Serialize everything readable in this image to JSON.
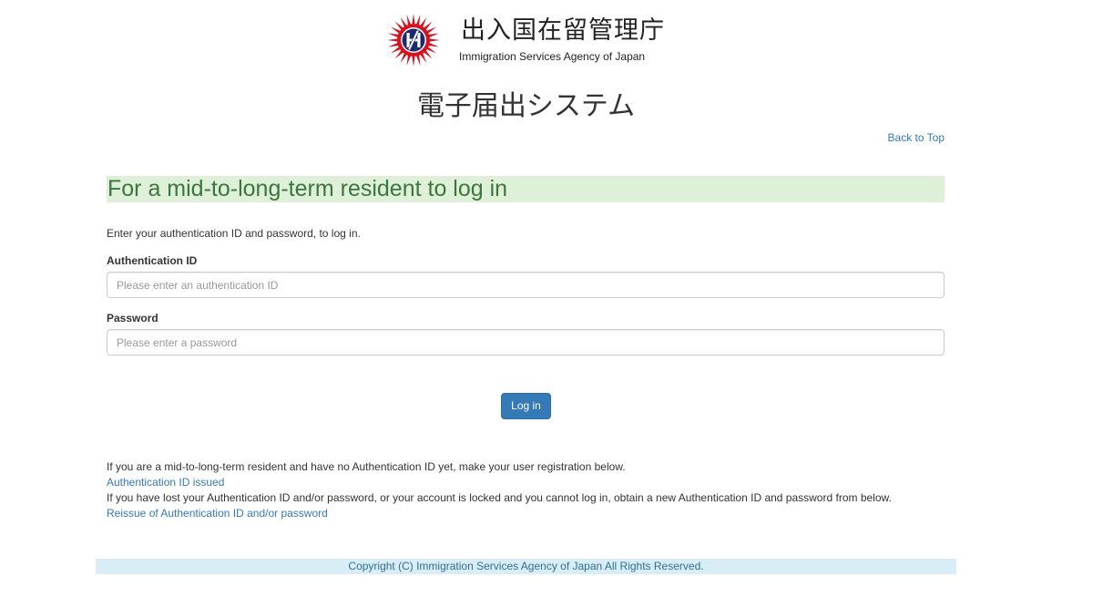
{
  "header": {
    "agency_name_jp": "出入国在留管理庁",
    "agency_name_en": "Immigration Services Agency of Japan",
    "system_title": "電子届出システム",
    "back_to_top": "Back to Top",
    "emblem_icon": "agency-emblem-icon"
  },
  "login": {
    "heading": "For a mid-to-long-term resident to log in",
    "intro": "Enter your authentication ID and password, to log in.",
    "auth_id_label": "Authentication ID",
    "auth_id_placeholder": "Please enter an authentication ID",
    "auth_id_value": "",
    "password_label": "Password",
    "password_placeholder": "Please enter a password",
    "password_value": "",
    "submit_label": "Log in"
  },
  "help": {
    "registration_text": "If you are a mid-to-long-term resident and have no Authentication ID yet, make your user registration below.",
    "registration_link": "Authentication ID issued",
    "reissue_text": "If you have lost your Authentication ID and/or password, or your account is locked and you cannot log in, obtain a new Authentication ID and password from below.",
    "reissue_link": "Reissue of Authentication ID and/or password"
  },
  "footer": {
    "copyright": "Copyright (C) Immigration Services Agency of Japan All Rights Reserved."
  },
  "colors": {
    "emblem_red": "#d7121f",
    "emblem_navy": "#1b2a6b",
    "link_blue": "#337ab7",
    "heading_bg": "#dff0d8",
    "heading_text": "#3c763d",
    "footer_bg": "#d9edf7",
    "footer_text": "#31708f",
    "button_bg": "#337ab7"
  }
}
